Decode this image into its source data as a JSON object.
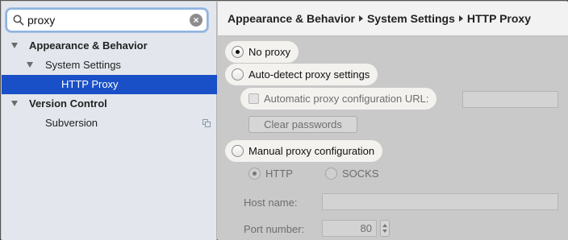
{
  "search": {
    "value": "proxy",
    "clear_icon": "×"
  },
  "tree": [
    {
      "label": "Appearance & Behavior",
      "level": 0,
      "bold": true,
      "expanded": true
    },
    {
      "label": "System Settings",
      "level": 1,
      "bold": false,
      "expanded": true
    },
    {
      "label": "HTTP Proxy",
      "level": 2,
      "bold": false,
      "selected": true
    },
    {
      "label": "Version Control",
      "level": 0,
      "bold": true,
      "expanded": true
    },
    {
      "label": "Subversion",
      "level": 1,
      "bold": false,
      "icon": "project-settings-icon"
    }
  ],
  "breadcrumb": [
    "Appearance & Behavior",
    "System Settings",
    "HTTP Proxy"
  ],
  "proxy": {
    "no_proxy": "No proxy",
    "auto_detect": "Auto-detect proxy settings",
    "auto_config_url": "Automatic proxy configuration URL:",
    "clear_passwords": "Clear passwords",
    "manual": "Manual proxy configuration",
    "http": "HTTP",
    "socks": "SOCKS",
    "host_name": "Host name:",
    "port_number": "Port number:",
    "port_value": "80",
    "selected_mode": "No proxy"
  },
  "colors": {
    "selection": "#1a50c7",
    "sidebar_bg": "#e3e7ed",
    "content_bg": "#c9c9c9"
  }
}
